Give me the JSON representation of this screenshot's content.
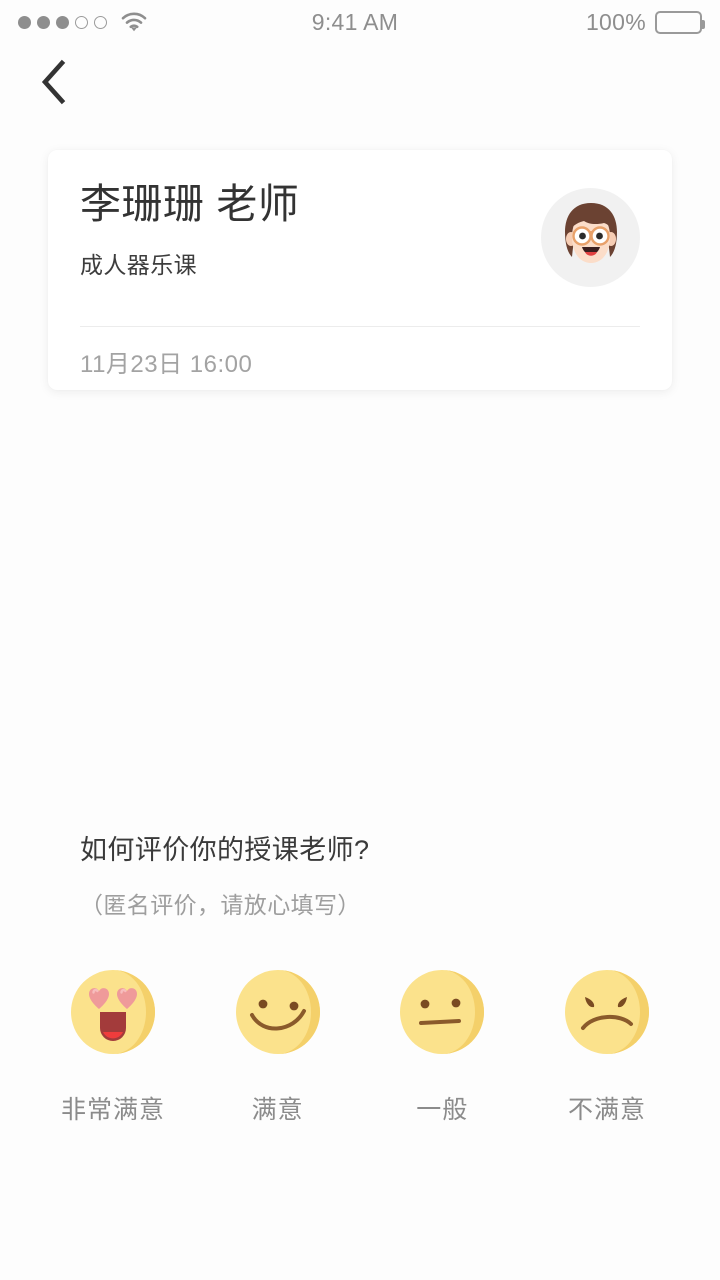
{
  "status_bar": {
    "signal_filled": 3,
    "signal_total": 5,
    "wifi_icon": "wifi-icon",
    "time": "9:41 AM",
    "battery_percent": "100%",
    "battery_icon": "battery-full-icon"
  },
  "nav": {
    "back_icon": "chevron-left-icon"
  },
  "card": {
    "teacher_name": "李珊珊 老师",
    "course_name": "成人器乐课",
    "lesson_time": "11月23日 16:00",
    "avatar_icon": "woman-with-glasses-avatar"
  },
  "rating": {
    "question": "如何评价你的授课老师?",
    "note": "（匿名评价，请放心填写）",
    "options": [
      {
        "label": "非常满意",
        "icon": "heart-eyes-emoji",
        "value": 4
      },
      {
        "label": "满意",
        "icon": "smiling-emoji",
        "value": 3
      },
      {
        "label": "一般",
        "icon": "neutral-emoji",
        "value": 2
      },
      {
        "label": "不满意",
        "icon": "frowning-emoji",
        "value": 1
      }
    ]
  },
  "colors": {
    "background": "#fdfdfd",
    "card_background": "#ffffff",
    "title_text": "#333333",
    "muted_text": "#9e9e9e",
    "emoji_yellow": "#fbe28c",
    "emoji_yellow_shade": "#f4d06a",
    "emoji_feature": "#8a5a2b",
    "heart_pink": "#ef9a9a",
    "mouth_dark": "#a33b3b",
    "tongue_red": "#f03c3c"
  }
}
